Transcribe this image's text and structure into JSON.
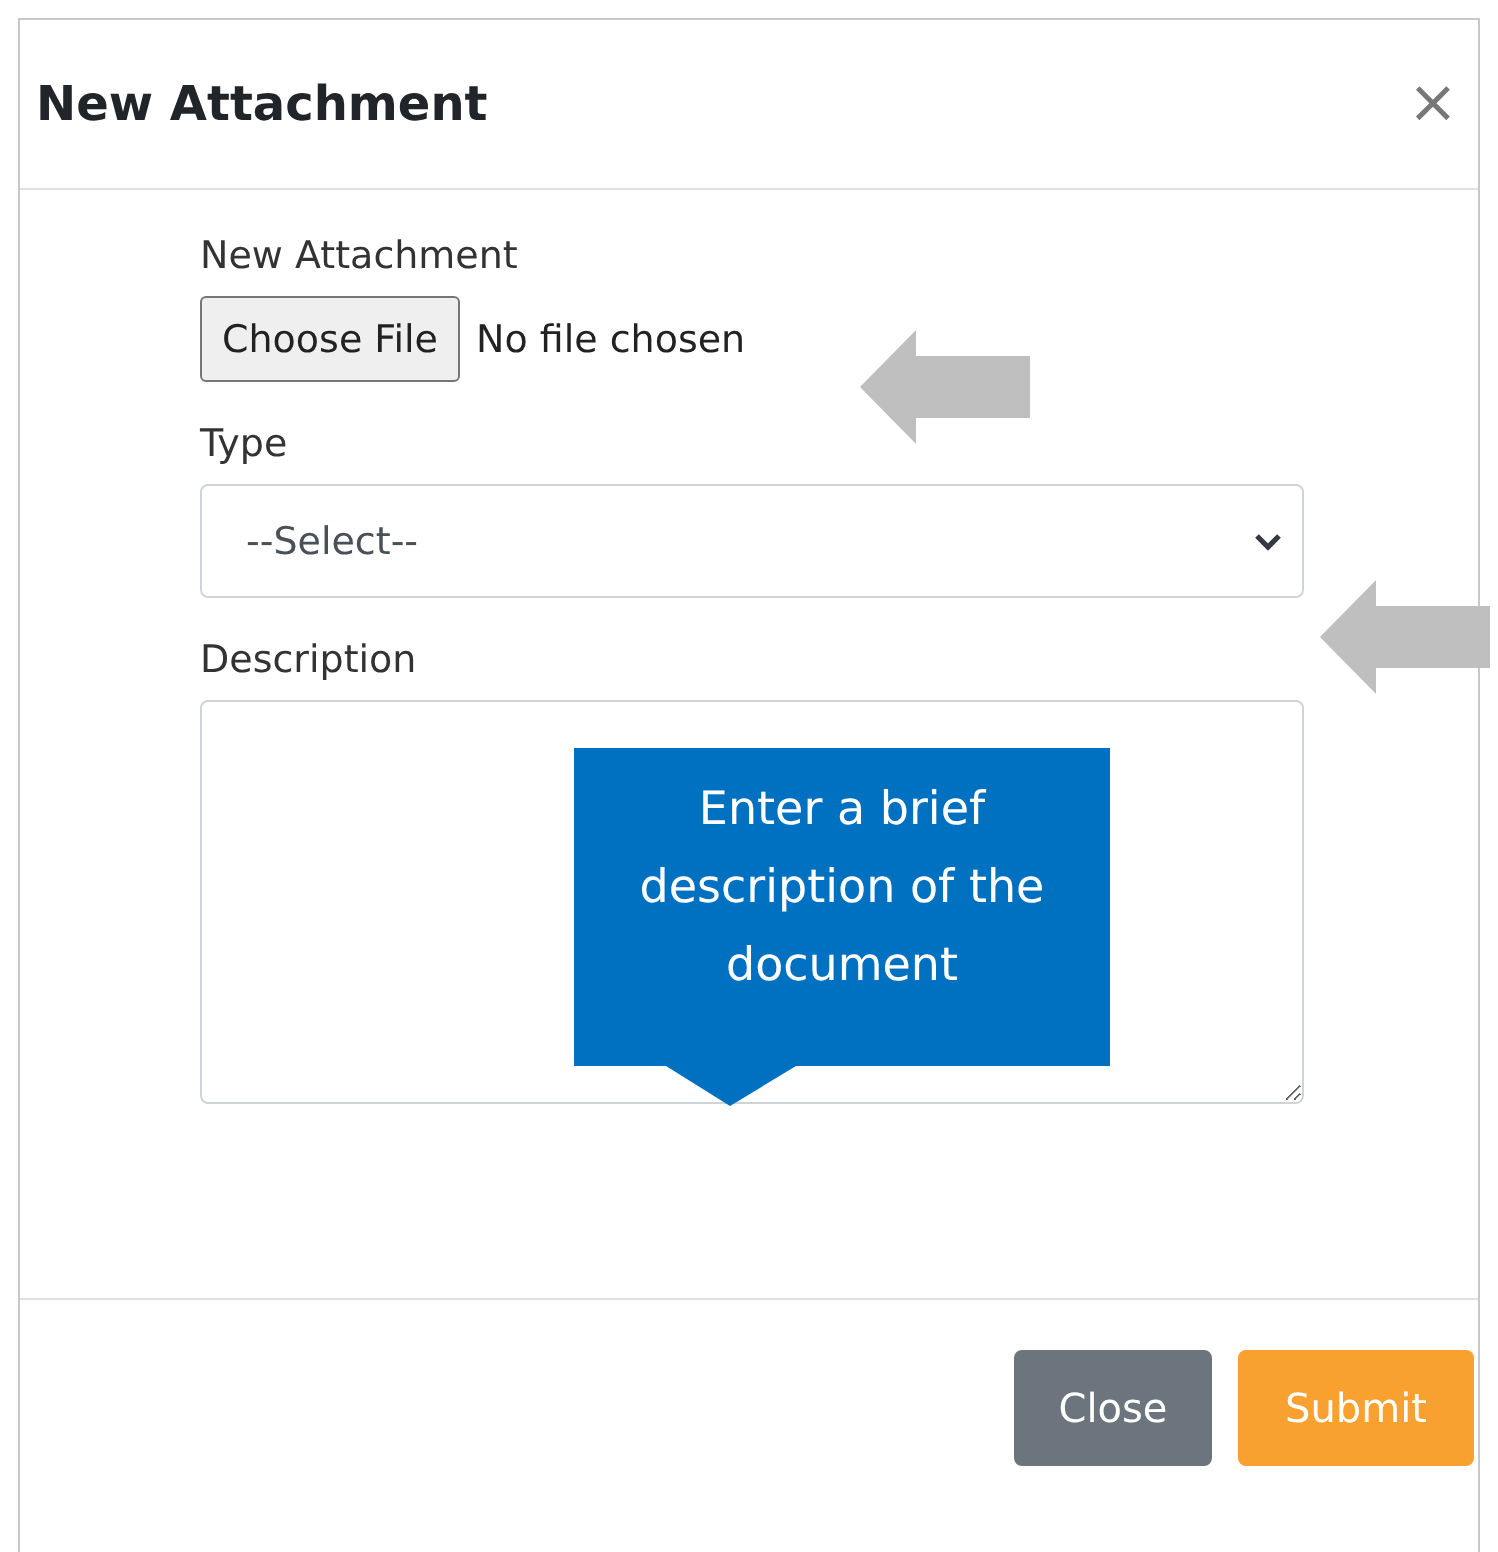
{
  "dialog": {
    "title": "New Attachment",
    "close_icon": "×"
  },
  "fields": [
    {
      "kind": "file",
      "label": "New Attachment",
      "button": "Choose File",
      "status": "No file chosen"
    },
    {
      "kind": "select",
      "label": "Type",
      "value": "--Select--"
    },
    {
      "kind": "textarea",
      "label": "Description"
    }
  ],
  "callout": {
    "text": "Enter a brief description of the document"
  },
  "buttons": [
    {
      "label": "Close",
      "kind": "secondary"
    },
    {
      "label": "Submit",
      "kind": "primary"
    }
  ]
}
